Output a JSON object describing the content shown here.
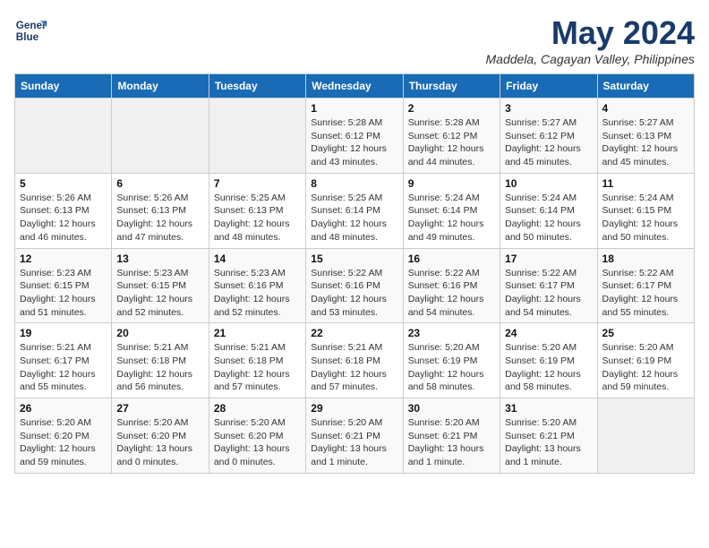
{
  "logo": {
    "line1": "General",
    "line2": "Blue"
  },
  "title": "May 2024",
  "location": "Maddela, Cagayan Valley, Philippines",
  "weekdays": [
    "Sunday",
    "Monday",
    "Tuesday",
    "Wednesday",
    "Thursday",
    "Friday",
    "Saturday"
  ],
  "weeks": [
    [
      {
        "day": "",
        "info": ""
      },
      {
        "day": "",
        "info": ""
      },
      {
        "day": "",
        "info": ""
      },
      {
        "day": "1",
        "info": "Sunrise: 5:28 AM\nSunset: 6:12 PM\nDaylight: 12 hours\nand 43 minutes."
      },
      {
        "day": "2",
        "info": "Sunrise: 5:28 AM\nSunset: 6:12 PM\nDaylight: 12 hours\nand 44 minutes."
      },
      {
        "day": "3",
        "info": "Sunrise: 5:27 AM\nSunset: 6:12 PM\nDaylight: 12 hours\nand 45 minutes."
      },
      {
        "day": "4",
        "info": "Sunrise: 5:27 AM\nSunset: 6:13 PM\nDaylight: 12 hours\nand 45 minutes."
      }
    ],
    [
      {
        "day": "5",
        "info": "Sunrise: 5:26 AM\nSunset: 6:13 PM\nDaylight: 12 hours\nand 46 minutes."
      },
      {
        "day": "6",
        "info": "Sunrise: 5:26 AM\nSunset: 6:13 PM\nDaylight: 12 hours\nand 47 minutes."
      },
      {
        "day": "7",
        "info": "Sunrise: 5:25 AM\nSunset: 6:13 PM\nDaylight: 12 hours\nand 48 minutes."
      },
      {
        "day": "8",
        "info": "Sunrise: 5:25 AM\nSunset: 6:14 PM\nDaylight: 12 hours\nand 48 minutes."
      },
      {
        "day": "9",
        "info": "Sunrise: 5:24 AM\nSunset: 6:14 PM\nDaylight: 12 hours\nand 49 minutes."
      },
      {
        "day": "10",
        "info": "Sunrise: 5:24 AM\nSunset: 6:14 PM\nDaylight: 12 hours\nand 50 minutes."
      },
      {
        "day": "11",
        "info": "Sunrise: 5:24 AM\nSunset: 6:15 PM\nDaylight: 12 hours\nand 50 minutes."
      }
    ],
    [
      {
        "day": "12",
        "info": "Sunrise: 5:23 AM\nSunset: 6:15 PM\nDaylight: 12 hours\nand 51 minutes."
      },
      {
        "day": "13",
        "info": "Sunrise: 5:23 AM\nSunset: 6:15 PM\nDaylight: 12 hours\nand 52 minutes."
      },
      {
        "day": "14",
        "info": "Sunrise: 5:23 AM\nSunset: 6:16 PM\nDaylight: 12 hours\nand 52 minutes."
      },
      {
        "day": "15",
        "info": "Sunrise: 5:22 AM\nSunset: 6:16 PM\nDaylight: 12 hours\nand 53 minutes."
      },
      {
        "day": "16",
        "info": "Sunrise: 5:22 AM\nSunset: 6:16 PM\nDaylight: 12 hours\nand 54 minutes."
      },
      {
        "day": "17",
        "info": "Sunrise: 5:22 AM\nSunset: 6:17 PM\nDaylight: 12 hours\nand 54 minutes."
      },
      {
        "day": "18",
        "info": "Sunrise: 5:22 AM\nSunset: 6:17 PM\nDaylight: 12 hours\nand 55 minutes."
      }
    ],
    [
      {
        "day": "19",
        "info": "Sunrise: 5:21 AM\nSunset: 6:17 PM\nDaylight: 12 hours\nand 55 minutes."
      },
      {
        "day": "20",
        "info": "Sunrise: 5:21 AM\nSunset: 6:18 PM\nDaylight: 12 hours\nand 56 minutes."
      },
      {
        "day": "21",
        "info": "Sunrise: 5:21 AM\nSunset: 6:18 PM\nDaylight: 12 hours\nand 57 minutes."
      },
      {
        "day": "22",
        "info": "Sunrise: 5:21 AM\nSunset: 6:18 PM\nDaylight: 12 hours\nand 57 minutes."
      },
      {
        "day": "23",
        "info": "Sunrise: 5:20 AM\nSunset: 6:19 PM\nDaylight: 12 hours\nand 58 minutes."
      },
      {
        "day": "24",
        "info": "Sunrise: 5:20 AM\nSunset: 6:19 PM\nDaylight: 12 hours\nand 58 minutes."
      },
      {
        "day": "25",
        "info": "Sunrise: 5:20 AM\nSunset: 6:19 PM\nDaylight: 12 hours\nand 59 minutes."
      }
    ],
    [
      {
        "day": "26",
        "info": "Sunrise: 5:20 AM\nSunset: 6:20 PM\nDaylight: 12 hours\nand 59 minutes."
      },
      {
        "day": "27",
        "info": "Sunrise: 5:20 AM\nSunset: 6:20 PM\nDaylight: 13 hours\nand 0 minutes."
      },
      {
        "day": "28",
        "info": "Sunrise: 5:20 AM\nSunset: 6:20 PM\nDaylight: 13 hours\nand 0 minutes."
      },
      {
        "day": "29",
        "info": "Sunrise: 5:20 AM\nSunset: 6:21 PM\nDaylight: 13 hours\nand 1 minute."
      },
      {
        "day": "30",
        "info": "Sunrise: 5:20 AM\nSunset: 6:21 PM\nDaylight: 13 hours\nand 1 minute."
      },
      {
        "day": "31",
        "info": "Sunrise: 5:20 AM\nSunset: 6:21 PM\nDaylight: 13 hours\nand 1 minute."
      },
      {
        "day": "",
        "info": ""
      }
    ]
  ]
}
